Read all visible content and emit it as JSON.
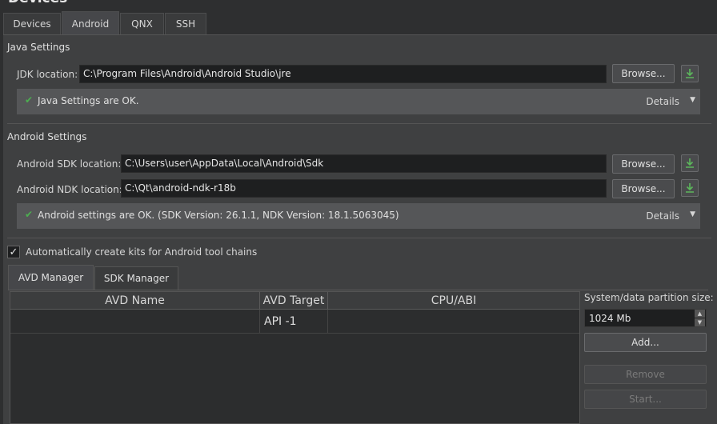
{
  "window": {
    "title": "Devices"
  },
  "tabs": [
    "Devices",
    "Android",
    "QNX",
    "SSH"
  ],
  "java": {
    "group_title": "Java Settings",
    "jdk_label": "JDK location:",
    "jdk_value": "C:\\Program Files\\Android\\Android Studio\\jre",
    "browse_label": "Browse...",
    "status_text": "Java Settings are OK.",
    "details_label": "Details"
  },
  "android": {
    "group_title": "Android Settings",
    "sdk_label": "Android SDK location:",
    "sdk_value": "C:\\Users\\user\\AppData\\Local\\Android\\Sdk",
    "ndk_label": "Android NDK location:",
    "ndk_value": "C:\\Qt\\android-ndk-r18b",
    "browse_label": "Browse...",
    "status_text": "Android settings are OK. (SDK Version: 26.1.1, NDK Version: 18.1.5063045)",
    "details_label": "Details"
  },
  "auto_kits": {
    "label": "Automatically create kits for Android tool chains",
    "checked": true
  },
  "subtabs": [
    "AVD Manager",
    "SDK Manager"
  ],
  "avd_table": {
    "columns": [
      "AVD Name",
      "AVD Target",
      "CPU/ABI"
    ],
    "rows": [
      [
        "",
        "API -1",
        ""
      ]
    ]
  },
  "side": {
    "partition_label": "System/data partition size:",
    "partition_value": "1024 Mb",
    "add_label": "Add...",
    "remove_label": "Remove",
    "start_label": "Start..."
  },
  "colors": {
    "accent_ok": "#4caf50",
    "download_icon": "#5cb85c"
  }
}
